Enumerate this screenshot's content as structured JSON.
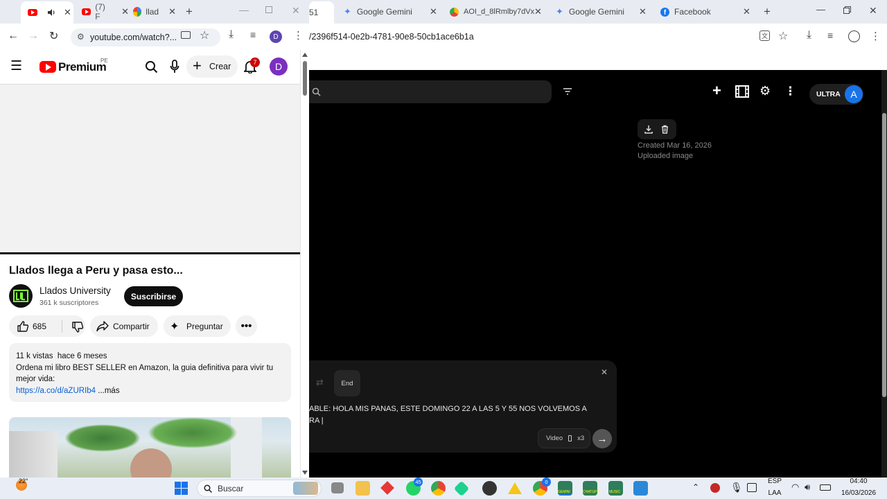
{
  "left_browser": {
    "tabs": [
      {
        "title": "",
        "audio": true
      },
      {
        "title": "(7) F"
      },
      {
        "title": "llad"
      }
    ],
    "url": "youtube.com/watch?...",
    "profile_initial": "D"
  },
  "youtube": {
    "logo_text": "Premium",
    "region": "PE",
    "create_label": "Crear",
    "notification_count": "7",
    "avatar_initial": "D",
    "video_title": "Llados llega a Peru y pasa esto...",
    "channel_name": "Llados University",
    "subscribers": "361 k suscriptores",
    "subscribe_label": "Suscribirse",
    "likes": "685",
    "share_label": "Compartir",
    "ask_label": "Preguntar",
    "description": {
      "views": "11 k vistas",
      "date": "hace 6 meses",
      "line1": "Ordena mi libro BEST SELLER en Amazon, la guia definitiva para vivir tu",
      "line2": "mejor vida:",
      "link": "https://a.co/d/aZURIb4",
      "more": "...más"
    }
  },
  "right_browser": {
    "tabs": [
      {
        "title": "51",
        "partial": true
      },
      {
        "title": "Google Gemini"
      },
      {
        "title": "AOI_d_8lRmlby7dVx"
      },
      {
        "title": "Google Gemini"
      },
      {
        "title": "Facebook"
      }
    ],
    "url": "/2396f514-0e2b-4781-90e8-50cb1ace6b1a"
  },
  "flow": {
    "plan_label": "ULTRA",
    "avatar_initial": "A",
    "created": "Created Mar 16, 2026",
    "uploaded": "Uploaded image",
    "end_label": "End",
    "prompt_line1": "ABLE: HOLA MIS PANAS, ESTE DOMINGO 22 A LAS 5 Y 55 NOS VOLVEMOS A",
    "prompt_line2": "RA |",
    "video_label": "Video",
    "multiplier": "x3"
  },
  "taskbar": {
    "weather_temp": "22°",
    "search_placeholder": "Buscar",
    "whatsapp_badge": "45",
    "chrome_badge": "0",
    "language": "ESP",
    "language_sub": "LAA",
    "time": "04:40",
    "date": "16/03/2026",
    "app_labels": [
      "GEMINI",
      "CHATGPT",
      "MUSIC"
    ]
  },
  "colors": {
    "youtube_red": "#ff0000",
    "flow_bg": "#000000",
    "accent_blue": "#1a73e8",
    "notif_red": "#cc0000"
  }
}
